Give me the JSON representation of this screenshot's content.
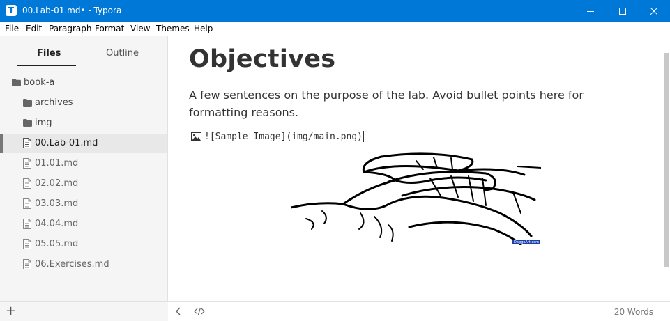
{
  "window": {
    "title": "00.Lab-01.md• - Typora",
    "app_icon_letter": "T",
    "accent": "#0078d7"
  },
  "menu": [
    "File",
    "Edit",
    "Paragraph",
    "Format",
    "View",
    "Themes",
    "Help"
  ],
  "sidebar": {
    "tabs": {
      "files": "Files",
      "outline": "Outline"
    },
    "active_tab": "Files",
    "tree": [
      {
        "label": "book-a",
        "kind": "folder",
        "icon": "folder-icon"
      },
      {
        "label": "archives",
        "kind": "folder",
        "icon": "folder-icon"
      },
      {
        "label": "img",
        "kind": "folder",
        "icon": "folder-icon"
      },
      {
        "label": "00.Lab-01.md",
        "kind": "file",
        "icon": "file-icon",
        "active": true
      },
      {
        "label": "01.01.md",
        "kind": "file",
        "icon": "file-icon"
      },
      {
        "label": "02.02.md",
        "kind": "file",
        "icon": "file-icon"
      },
      {
        "label": "03.03.md",
        "kind": "file",
        "icon": "file-icon"
      },
      {
        "label": "04.04.md",
        "kind": "file",
        "icon": "file-icon"
      },
      {
        "label": "05.05.md",
        "kind": "file",
        "icon": "file-icon"
      },
      {
        "label": "06.Exercises.md",
        "kind": "file",
        "icon": "file-icon"
      }
    ],
    "add_label": "+"
  },
  "editor": {
    "heading": "Objectives",
    "paragraph": "A few sentences on the purpose of the lab. Avoid bullet points here for formatting reasons.",
    "image_source": "![Sample Image](img/main.png)",
    "image_watermark": "DoggoArt.com"
  },
  "status": {
    "word_count": "20 Words",
    "back_glyph": "‹",
    "source_glyph": "</>"
  }
}
